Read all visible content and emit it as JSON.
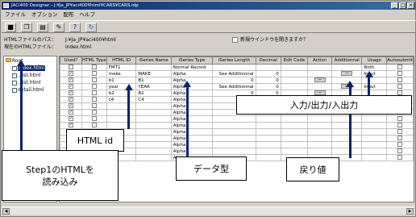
{
  "window": {
    "title": "JACi400 Designer - J:¥Ja_JP¥aci400¥html¥CARS¥CARS.idp"
  },
  "menu": [
    "ファイル",
    "オプション",
    "配布",
    "ヘルプ"
  ],
  "toolbar": {
    "icons": [
      "save-icon",
      "copy-icon",
      "paste-icon",
      "settings-icon",
      "help-icon",
      "refresh-icon"
    ]
  },
  "info": {
    "path_label": "HTMLファイルのパス：",
    "path_value": "J:¥Ja_JP¥aci400¥html",
    "current_label": "現在のHTMLファイル：",
    "current_value": "index.html",
    "new_window_label": "新規ウインドウを開きますか？"
  },
  "tree": {
    "root": "Root",
    "items": [
      "index.html",
      "...ist.html",
      "...ist.html",
      "detail.html"
    ]
  },
  "grid": {
    "headers": [
      "Used?",
      "HTML Type",
      "HTML ID",
      "iSeries Name",
      "iSeries Type",
      "iSeries Length",
      "Decimal",
      "Edit Code",
      "Action",
      "Additionnal",
      "Usage",
      "Autosubmit"
    ],
    "rows": [
      {
        "id": "FMT1",
        "name": "",
        "type": "Normal Record",
        "length": "",
        "decimal": "",
        "usage": "Both"
      },
      {
        "id": "make",
        "name": "MAKE",
        "type": "Alpha",
        "length": "See Additionnal",
        "decimal": "0",
        "usage": "Input"
      },
      {
        "id": "b1",
        "name": "B1",
        "type": "Alpha",
        "length": "0",
        "decimal": "0",
        "usage": ""
      },
      {
        "id": "year",
        "name": "YEAR",
        "type": "Alpha",
        "length": "See Additionnal",
        "decimal": "0",
        "usage": "Input"
      },
      {
        "id": "b2",
        "name": "B2",
        "type": "Alpha",
        "length": "0",
        "decimal": "0",
        "usage": ""
      },
      {
        "id": "c4",
        "name": "C4",
        "type": "Alpha",
        "length": "1",
        "decimal": "0",
        "usage": "Input"
      },
      {
        "id": "",
        "name": "",
        "type": "Alpha",
        "length": "",
        "decimal": "",
        "usage": ""
      },
      {
        "id": "",
        "name": "",
        "type": "Alpha",
        "length": "",
        "decimal": "",
        "usage": ""
      },
      {
        "id": "",
        "name": "",
        "type": "Alpha",
        "length": "",
        "decimal": "",
        "usage": ""
      },
      {
        "id": "",
        "name": "",
        "type": "Alpha",
        "length": "",
        "decimal": "",
        "usage": ""
      },
      {
        "id": "",
        "name": "",
        "type": "Alpha",
        "length": "",
        "decimal": "",
        "usage": ""
      },
      {
        "id": "",
        "name": "",
        "type": "Alpha",
        "length": "",
        "decimal": "",
        "usage": ""
      },
      {
        "id": "",
        "name": "",
        "type": "Alpha",
        "length": "",
        "decimal": "",
        "usage": ""
      },
      {
        "id": "",
        "name": "",
        "type": "Alpha",
        "length": "",
        "decimal": "",
        "usage": ""
      },
      {
        "id": "",
        "name": "",
        "type": "Alpha",
        "length": "",
        "decimal": "",
        "usage": ""
      }
    ]
  },
  "callouts": {
    "html_id": "HTML id",
    "io": "入力/出力/入出力",
    "step1_line1": "Step1のHTMLを",
    "step1_line2": "読み込み",
    "data_type": "データ型",
    "return_value": "戻り値"
  }
}
